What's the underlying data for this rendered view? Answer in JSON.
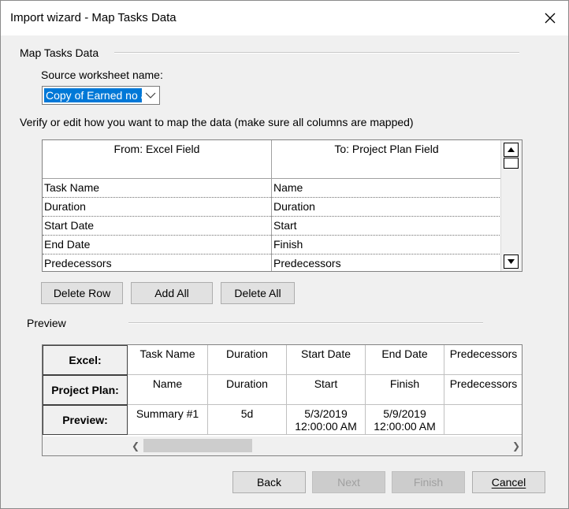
{
  "window": {
    "title": "Import wizard - Map Tasks Data"
  },
  "section": {
    "label": "Map Tasks Data"
  },
  "source": {
    "label": "Source worksheet name:",
    "value": "Copy of Earned no a"
  },
  "instructions": "Verify or edit how you want to map the data (make sure all columns are mapped)",
  "mapping": {
    "headers": [
      "From: Excel Field",
      "To: Project Plan Field"
    ],
    "rows": [
      {
        "from": "Task Name",
        "to": "Name"
      },
      {
        "from": "Duration",
        "to": "Duration"
      },
      {
        "from": "Start Date",
        "to": "Start"
      },
      {
        "from": "End Date",
        "to": "Finish"
      },
      {
        "from": "Predecessors",
        "to": "Predecessors"
      }
    ]
  },
  "row_buttons": {
    "delete_row": "Delete Row",
    "add_all": "Add All",
    "delete_all": "Delete All"
  },
  "preview": {
    "label": "Preview",
    "row_headers": [
      "Excel:",
      "Project Plan:",
      "Preview:"
    ],
    "excel": [
      "Task Name",
      "Duration",
      "Start Date",
      "End Date",
      "Predecessors"
    ],
    "project": [
      "Name",
      "Duration",
      "Start",
      "Finish",
      "Predecessors"
    ],
    "values": [
      [
        "Summary #1"
      ],
      [
        "5d"
      ],
      [
        "5/3/2019",
        "12:00:00 AM"
      ],
      [
        "5/9/2019",
        "12:00:00 AM"
      ],
      [
        ""
      ]
    ]
  },
  "footer": {
    "back": "Back",
    "next": "Next",
    "finish": "Finish",
    "cancel": "Cancel"
  },
  "colors": {
    "selection": "#0078d7",
    "face": "#f0f0f0",
    "button": "#e1e1e1"
  }
}
